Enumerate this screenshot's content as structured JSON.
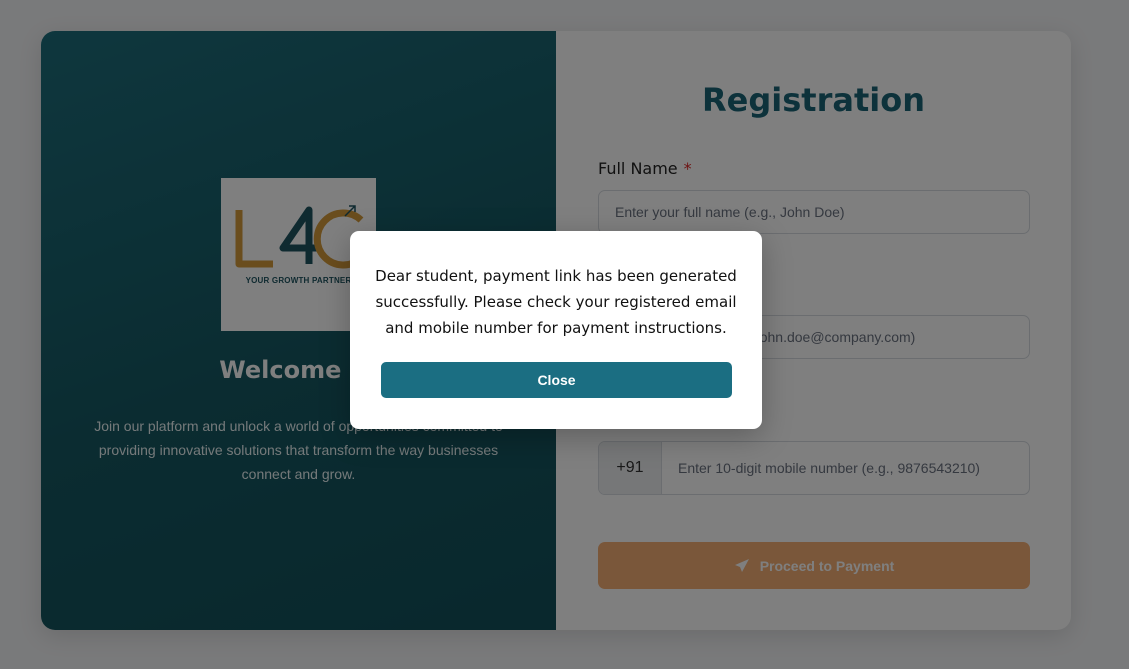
{
  "brand": {
    "logo_text": "L4G",
    "tagline": "YOUR GROWTH PARTNER"
  },
  "welcome": {
    "title": "Welcome to",
    "description": "Join our platform and unlock a world of opportunities committed to providing innovative solutions that transform the way businesses connect and grow."
  },
  "form": {
    "title": "Registration",
    "full_name": {
      "label": "Full Name",
      "required_mark": "*",
      "placeholder": "Enter your full name (e.g., John Doe)"
    },
    "email": {
      "placeholder": "Enter your email (e.g., john.doe@company.com)"
    },
    "phone": {
      "prefix": "+91",
      "placeholder": "Enter 10-digit mobile number (e.g., 9876543210)"
    },
    "submit_label": "Proceed to Payment"
  },
  "modal": {
    "message": "Dear student, payment link has been generated successfully. Please check your registered email and mobile number for payment instructions.",
    "close_label": "Close"
  },
  "colors": {
    "brand_teal": "#1b6577",
    "accent_orange": "#f4ae74",
    "required_red": "#dc2626"
  },
  "icons": {
    "submit_icon": "paper-plane-icon"
  }
}
